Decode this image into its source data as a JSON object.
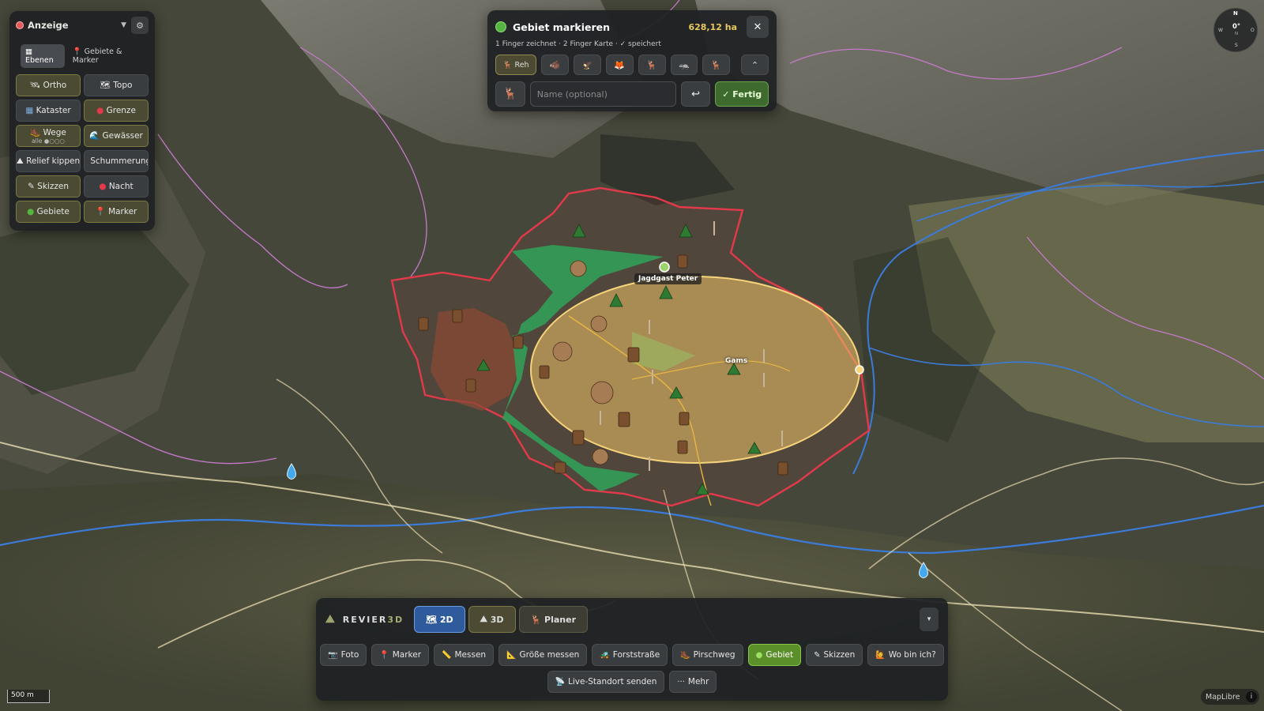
{
  "anzeige": {
    "title": "Anzeige",
    "tabs": [
      "Ebenen",
      "Gebiete & Marker"
    ],
    "tab_icons": [
      "▦",
      "📍"
    ],
    "buttons": [
      {
        "icon": "🛰",
        "label": "Ortho",
        "sub": ""
      },
      {
        "icon": "🗺",
        "label": "Topo",
        "sub": ""
      },
      {
        "icon": "▦",
        "label": "Kataster",
        "sub": ""
      },
      {
        "icon": "●",
        "label": "Grenze",
        "sub": ""
      },
      {
        "icon": "🥾",
        "label": "Wege",
        "sub": "alle ●○○○"
      },
      {
        "icon": "🌊",
        "label": "Gewässer",
        "sub": ""
      },
      {
        "icon": "⛰",
        "label": "Relief kippen",
        "sub": ""
      },
      {
        "icon": "▌",
        "label": "Schummerung",
        "sub": ""
      },
      {
        "icon": "✎",
        "label": "Skizzen",
        "sub": ""
      },
      {
        "icon": "●",
        "label": "Nacht",
        "sub": ""
      },
      {
        "icon": "●",
        "label": "Gebiete",
        "sub": ""
      },
      {
        "icon": "📍",
        "label": "Marker",
        "sub": ""
      }
    ]
  },
  "gebiet": {
    "title": "Gebiet markieren",
    "area": "628,12 ha",
    "close": "✕",
    "hint": "1 Finger zeichnet · 2 Finger Karte · ✓ speichert",
    "selected_species": "Reh",
    "species_icons": [
      "🦌",
      "🐗",
      "🦅",
      "🦊",
      "🦌",
      "🦡",
      "🦌"
    ],
    "collapse": "⌃",
    "deer_icon": "🦌",
    "name_placeholder": "Name (optional)",
    "undo": "↩",
    "done": "✓ Fertig"
  },
  "map_labels": {
    "person": "Jagdgast Peter",
    "area_label": "Gams",
    "scale": "500 m",
    "attribution": "MapLibre",
    "info": "i"
  },
  "compass": {
    "n": "N",
    "deg": "0°",
    "w": "W",
    "o": "O",
    "s": "S",
    "nn": "N"
  },
  "toolbar": {
    "brand": "REVIER",
    "brand_suffix": "3D",
    "modes": [
      {
        "icon": "🗺",
        "label": "2D"
      },
      {
        "icon": "⛰",
        "label": "3D"
      },
      {
        "icon": "🦌",
        "label": "Planer"
      }
    ],
    "caret": "▾",
    "tools_row1": [
      {
        "icon": "📷",
        "label": "Foto"
      },
      {
        "icon": "📍",
        "label": "Marker"
      },
      {
        "icon": "📏",
        "label": "Messen"
      },
      {
        "icon": "📐",
        "label": "Größe messen"
      },
      {
        "icon": "🚜",
        "label": "Forststraße"
      },
      {
        "icon": "🥾",
        "label": "Pirschweg"
      },
      {
        "icon": "●",
        "label": "Gebiet"
      },
      {
        "icon": "✎",
        "label": "Skizzen"
      },
      {
        "icon": "🙋",
        "label": "Wo bin ich?"
      }
    ],
    "tools_row2": [
      {
        "icon": "📡",
        "label": "Live-Standort senden"
      },
      {
        "icon": "···",
        "label": "Mehr"
      }
    ]
  },
  "colors": {
    "boundary": "#e23a4a",
    "ellipse_fill": "#f2c46a",
    "green_area": "#2fa35a",
    "brown_area": "#8a4a35",
    "rivers": "#3b7bd9",
    "paths_pink": "#c47ac9",
    "paths_cream": "#e9dcb0"
  }
}
